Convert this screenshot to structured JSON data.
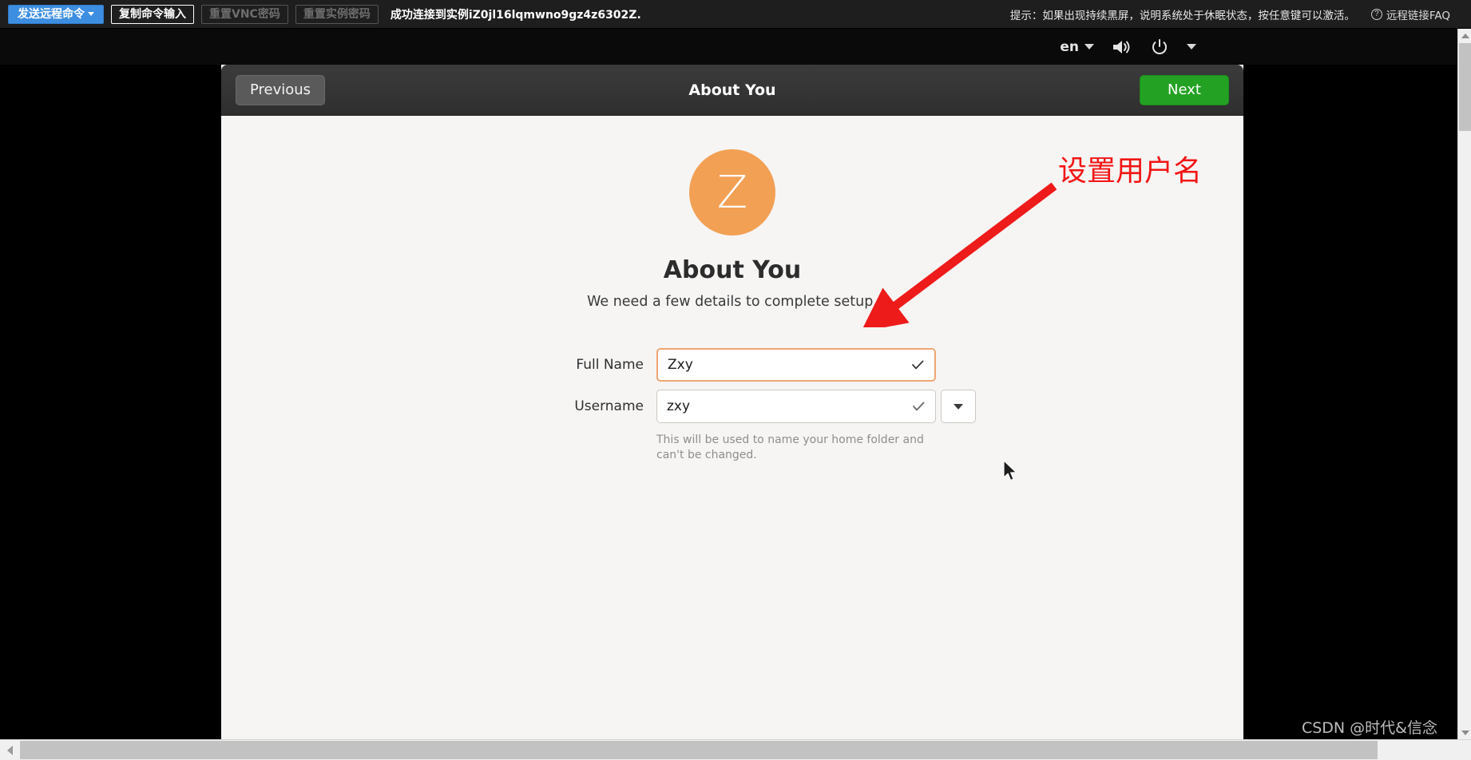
{
  "vnc_toolbar": {
    "send_command_button": "发送远程命令",
    "copy_input_button": "复制命令输入",
    "reset_vnc_password_button": "重置VNC密码",
    "reset_instance_password_button": "重置实例密码",
    "connection_status": "成功连接到实例iZ0jl16lqmwno9gz4z6302Z.",
    "hint": "提示：如果出现持续黑屏，说明系统处于休眠状态，按任意键可以激活。",
    "faq_link": "远程链接FAQ",
    "faq_icon": "question-circle-icon"
  },
  "gnome_bar": {
    "language": "en",
    "language_caret_icon": "chevron-down-icon",
    "volume_icon": "volume-icon",
    "power_icon": "power-icon",
    "menu_caret_icon": "chevron-down-icon"
  },
  "wizard": {
    "header": {
      "previous_label": "Previous",
      "title": "About You",
      "next_label": "Next",
      "next_color": "#23a123"
    },
    "avatar": {
      "initial": "Z",
      "color": "#f2a054"
    },
    "page_title": "About You",
    "page_subtitle": "We need a few details to complete setup.",
    "fields": [
      {
        "label": "Full Name",
        "value": "Zxy",
        "placeholder": "",
        "valid_icon": "checkmark-icon",
        "focused": true,
        "has_dropdown": false,
        "hint": ""
      },
      {
        "label": "Username",
        "value": "zxy",
        "placeholder": "",
        "valid_icon": "checkmark-icon",
        "focused": false,
        "has_dropdown": true,
        "dropdown_icon": "chevron-down-icon",
        "hint": "This will be used to name your home folder and can't be changed."
      }
    ]
  },
  "annotation": {
    "text": "设置用户名",
    "color": "#f21515",
    "arrow_icon": "arrow-pointer-icon"
  },
  "cursor": {
    "icon": "mouse-pointer-icon"
  },
  "watermark": "CSDN @时代&信念",
  "scrollbars": {
    "vertical_up_icon": "arrow-up-icon",
    "vertical_down_icon": "arrow-down-icon",
    "horizontal_left_icon": "arrow-left-icon"
  }
}
